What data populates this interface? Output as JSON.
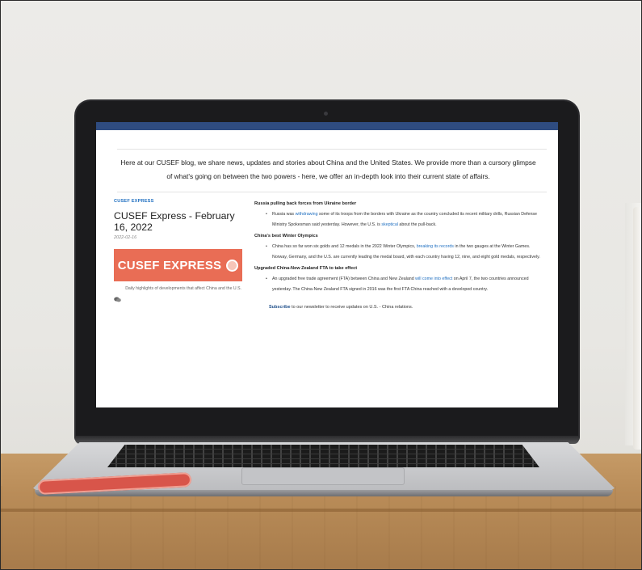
{
  "intro": {
    "line1": "Here at our CUSEF blog, we share news, updates and stories about China and the United States. We provide more than a cursory glimpse",
    "line2": "of what's going on between the two powers - here, we offer an in-depth look into their current state of affairs."
  },
  "sidebar": {
    "kicker": "CUSEF EXPRESS",
    "post_title": "CUSEF Express - February 16, 2022",
    "post_date": "2022-02-16",
    "banner_text": "CUSEF EXPRESS",
    "caption": "Daily highlights of developments that affect China and the U.S.",
    "comment_icon": "comment-icon"
  },
  "stories": [
    {
      "heading": "Russia pulling back forces from Ukraine border",
      "parts": {
        "a": "Russia was ",
        "link1": "withdrawing",
        "b": " some of its troops from the borders with Ukraine as the country concluded its recent military drills, Russian Defense Ministry Spokesman said yesterday. However, the U.S. is ",
        "link2": "skeptical",
        "c": " about the pull-back."
      }
    },
    {
      "heading": "China's best Winter Olympics",
      "parts": {
        "a": "China has so far won six golds and 12 medals in the 2022 Winter Olympics, ",
        "link1": "breaking its records",
        "b": " in the two gauges at the Winter Games. Norway, Germany, and the U.S. are currently leading the medal board, with each country having 12, nine, and eight gold medals, respectively."
      }
    },
    {
      "heading": "Upgraded China-New Zealand FTA to take effect",
      "parts": {
        "a": "An upgraded free trade agreement (FTA) between China and New Zealand ",
        "link1": "will come into effect",
        "b": " on April 7, the two countries announced yesterday. The China-New Zealand FTA signed in 2016 was the first FTA China reached with a developed country."
      }
    }
  ],
  "subscribe": {
    "link": "Subscribe",
    "rest": " to our newsletter to receive updates on U.S. - China relations."
  },
  "colors": {
    "accent_blue": "#1f6fc0",
    "banner_red": "#e96d55",
    "top_bar": "#2f4c80"
  }
}
